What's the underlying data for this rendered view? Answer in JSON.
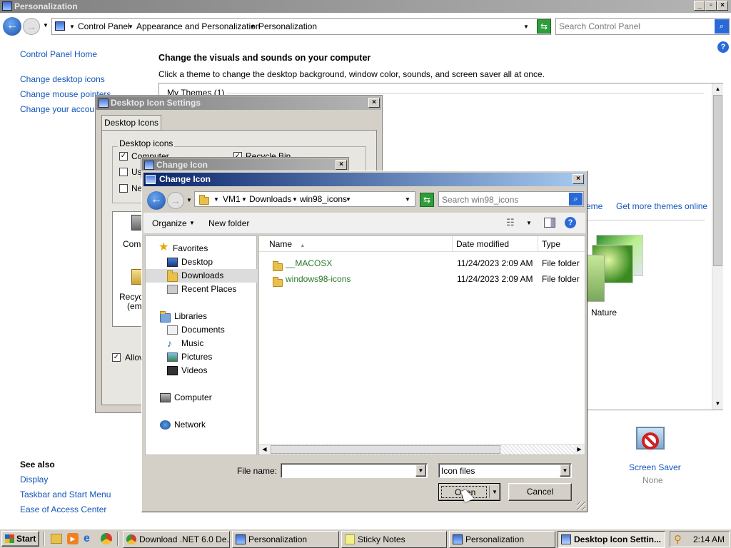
{
  "personalization": {
    "title": "Personalization",
    "breadcrumb": [
      "Control Panel",
      "Appearance and Personalization",
      "Personalization"
    ],
    "search_placeholder": "Search Control Panel",
    "sidebar_links": [
      "Control Panel Home",
      "Change desktop icons",
      "Change mouse pointers",
      "Change your account"
    ],
    "see_also_heading": "See also",
    "see_also_links": [
      "Display",
      "Taskbar and Start Menu",
      "Ease of Access Center"
    ],
    "heading": "Change the visuals and sounds on your computer",
    "subheading": "Click a theme to change the desktop background, window color, sounds, and screen saver all at once.",
    "my_themes": "My Themes (1)",
    "theme_link_partial": "eme",
    "get_more_themes": "Get more themes online",
    "nature_label": "Nature",
    "screen_saver_label": "Screen Saver",
    "screen_saver_value": "None"
  },
  "desktop_icon_settings": {
    "title": "Desktop Icon Settings",
    "tab": "Desktop Icons",
    "group_label": "Desktop icons",
    "checkboxes": [
      {
        "label": "Computer",
        "checked": true
      },
      {
        "label": "Recycle Bin",
        "checked": true
      },
      {
        "label": "Us",
        "checked": false
      },
      {
        "label": "Ne",
        "checked": false
      }
    ],
    "icon_computer": "Comp",
    "icon_recycle_1": "Recyc",
    "icon_recycle_2": "(emp",
    "allow_label": "Allov"
  },
  "change_icon_back": {
    "title": "Change Icon"
  },
  "change_icon": {
    "title": "Change Icon",
    "path": [
      "VM1",
      "Downloads",
      "win98_icons"
    ],
    "search_placeholder": "Search win98_icons",
    "organize": "Organize",
    "new_folder": "New folder",
    "columns": [
      "Name",
      "Date modified",
      "Type"
    ],
    "files": [
      {
        "name": "__MACOSX",
        "date": "11/24/2023 2:09 AM",
        "type": "File folder"
      },
      {
        "name": "windows98-icons",
        "date": "11/24/2023 2:09 AM",
        "type": "File folder"
      }
    ],
    "nav": {
      "favorites": "Favorites",
      "desktop": "Desktop",
      "downloads": "Downloads",
      "recent": "Recent Places",
      "libraries": "Libraries",
      "documents": "Documents",
      "music": "Music",
      "pictures": "Pictures",
      "videos": "Videos",
      "computer": "Computer",
      "network": "Network"
    },
    "file_name_label": "File name:",
    "file_name_value": "",
    "file_type": "Icon files",
    "open": "Open",
    "cancel": "Cancel"
  },
  "taskbar": {
    "start": "Start",
    "items": [
      "Download .NET 6.0 De...",
      "Personalization",
      "Sticky Notes",
      "Personalization",
      "Desktop Icon Settin..."
    ],
    "clock": "2:14 AM"
  },
  "colors": {
    "link": "#1155bb",
    "active_title": "#0a246a",
    "folder_link": "#2a7a2a"
  }
}
